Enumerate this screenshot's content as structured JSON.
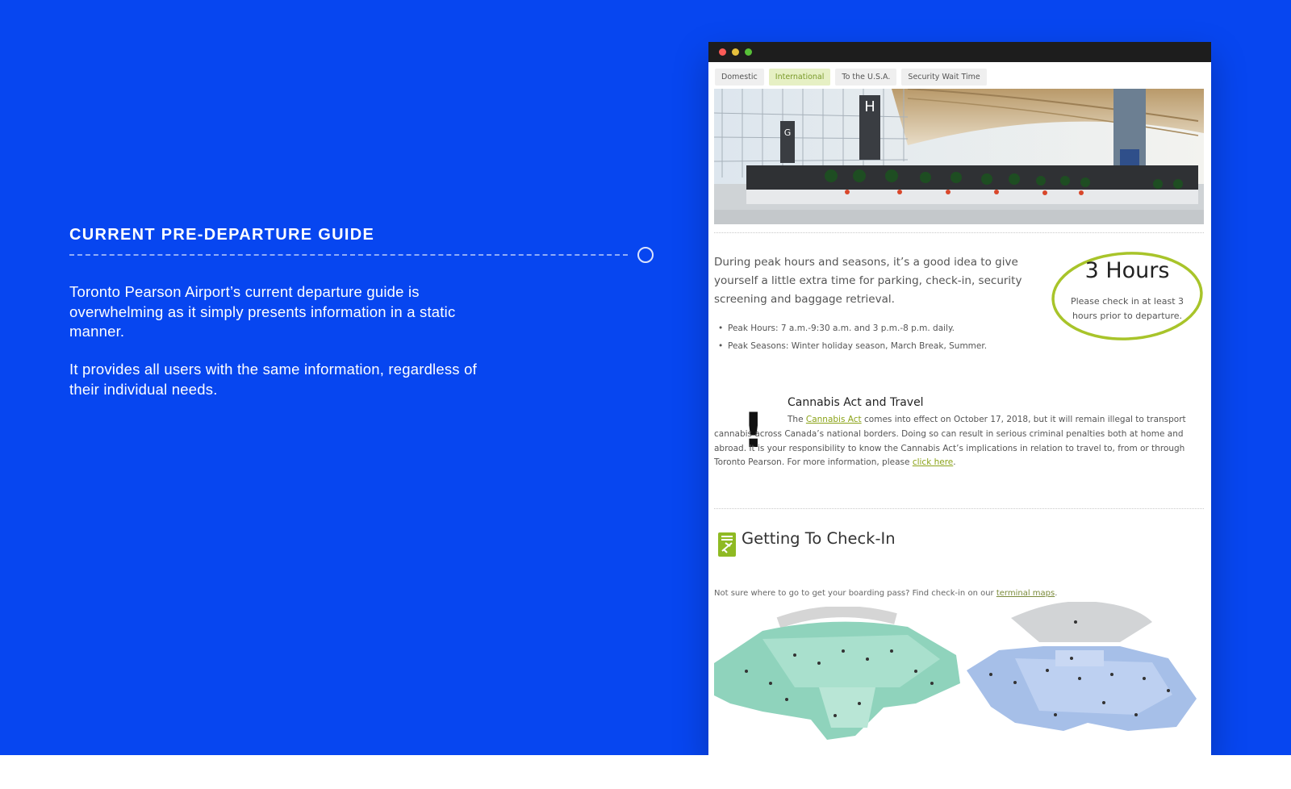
{
  "left": {
    "heading": "CURRENT PRE-DEPARTURE GUIDE",
    "paragraph1": "Toronto Pearson Airport’s current departure guide is overwhelming as it simply presents information in a static manner.",
    "paragraph2": "It provides all users with the same information, regardless of their individual needs."
  },
  "browser": {
    "tabs": [
      {
        "label": "Domestic"
      },
      {
        "label": "International",
        "active": true
      },
      {
        "label": "To the U.S.A."
      },
      {
        "label": "Security Wait Time"
      }
    ],
    "peak": {
      "text": "During peak hours and seasons, it’s a good idea to give yourself a little extra time for parking, check-in, security screening and baggage retrieval.",
      "bullets": [
        "Peak Hours: 7 a.m.-9:30 a.m. and 3 p.m.-8 p.m. daily.",
        "Peak Seasons: Winter holiday season, March Break, Summer."
      ]
    },
    "hours": {
      "title": "3 Hours",
      "subtitle": "Please check in at least 3 hours prior to departure."
    },
    "cannabis": {
      "title": "Cannabis Act and Travel",
      "intro": "The",
      "link_act": "Cannabis Act",
      "body": "comes into effect on October 17, 2018, but it will remain illegal to transport cannabis across Canada’s national borders. Doing so can result in serious criminal penalties both at home and abroad. It is your responsibility to know the Cannabis Act’s implications in relation to travel to, from or through Toronto Pearson. For more information, please",
      "link_click": "click here",
      "end": "."
    },
    "checkin": {
      "title": "Getting To Check-In",
      "note": "Not sure where to go to get your boarding pass? Find check-in on our",
      "link": "terminal maps",
      "note_end": "."
    }
  },
  "colors": {
    "background": "#0746f0",
    "accent_green": "#8ba318",
    "circle_green": "#a8c42a"
  },
  "icons": [
    "exclamation-icon",
    "boarding-pass-icon"
  ]
}
